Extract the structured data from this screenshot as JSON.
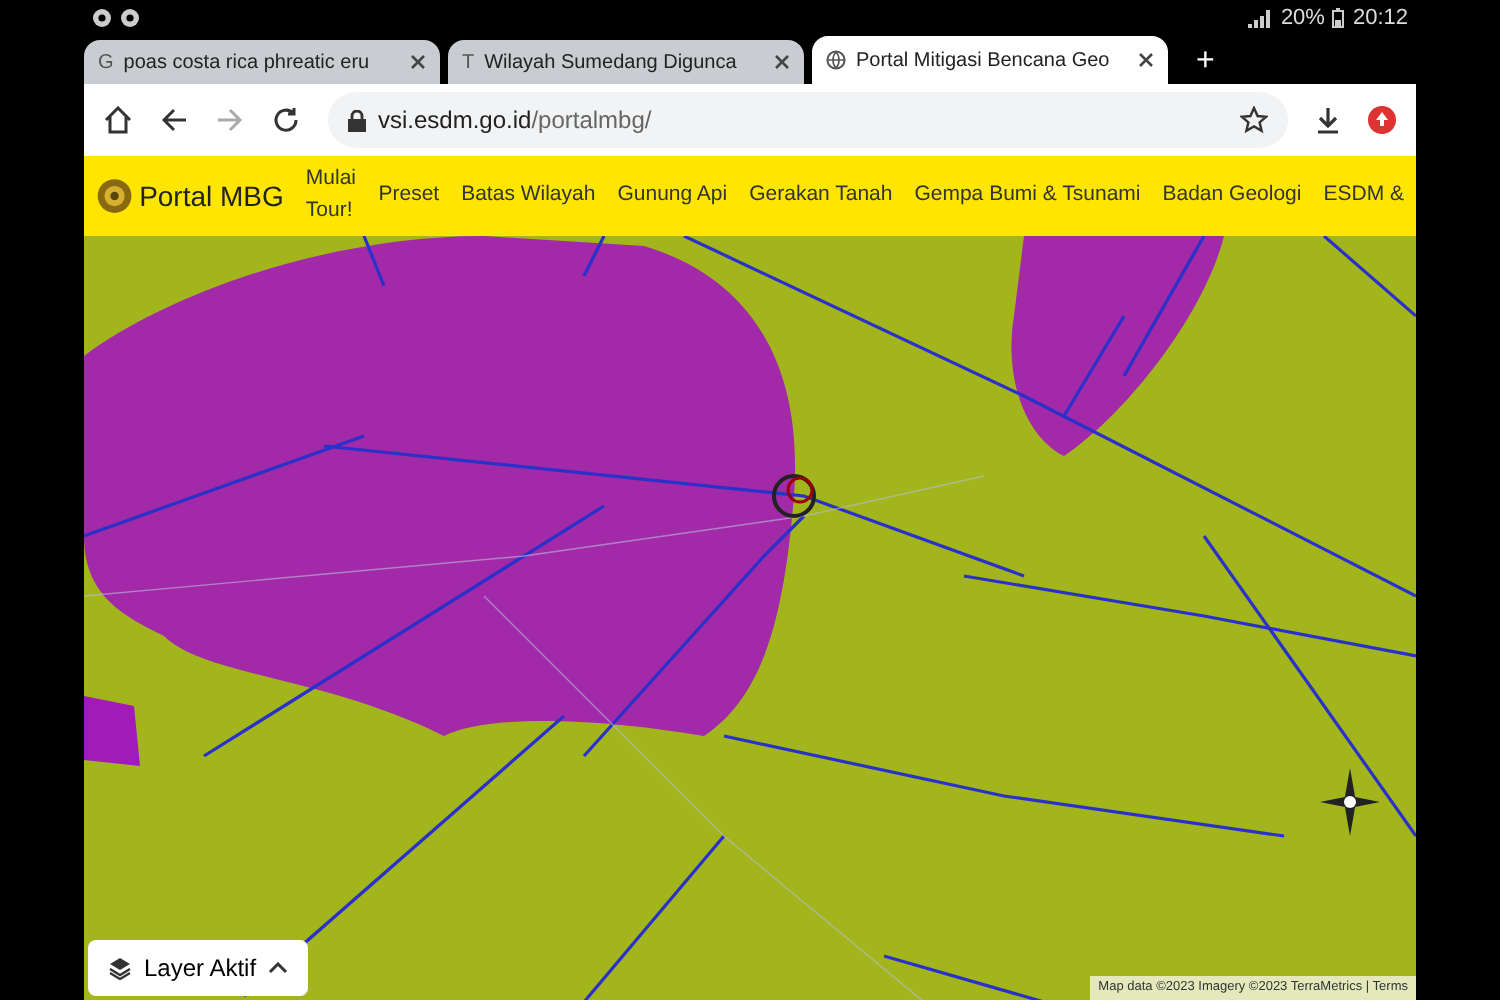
{
  "status_bar": {
    "battery": "20%",
    "time": "20:12"
  },
  "tabs": [
    {
      "title": "poas costa rica phreatic eru",
      "kind": "letter",
      "letter": "G",
      "selected": false
    },
    {
      "title": "Wilayah Sumedang Digunca",
      "kind": "letter",
      "letter": "T",
      "selected": false
    },
    {
      "title": "Portal Mitigasi Bencana Geo",
      "kind": "globe",
      "selected": true
    }
  ],
  "new_tab": "+",
  "address": {
    "domain": "vsi.esdm.go.id",
    "path": "/portalmbg/"
  },
  "site_nav": {
    "brand": "Portal MBG",
    "items": [
      "Mulai Tour!",
      "Preset",
      "Batas Wilayah",
      "Gunung Api",
      "Gerakan Tanah",
      "Gempa Bumi & Tsunami",
      "Badan Geologi",
      "ESDM &"
    ]
  },
  "map": {
    "layer_button": "Layer Aktif",
    "attribution": "Map data ©2023 Imagery ©2023 TerraMetrics | Terms"
  }
}
